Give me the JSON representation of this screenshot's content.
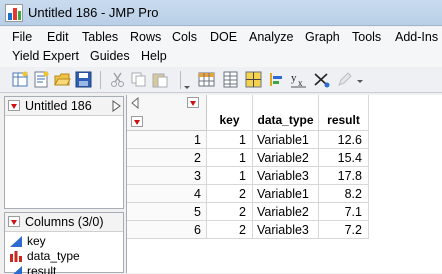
{
  "window": {
    "title": "Untitled 186 - JMP Pro"
  },
  "menu": {
    "row1": [
      "File",
      "Edit",
      "Tables",
      "Rows",
      "Cols",
      "DOE",
      "Analyze",
      "Graph",
      "Tools",
      "Add-Ins"
    ],
    "row2": [
      "Yield Expert",
      "Guides",
      "Help"
    ]
  },
  "toolbar": {
    "icons": [
      "new-data-table-icon",
      "new-script-icon",
      "open-icon",
      "save-icon",
      "cut-icon",
      "copy-icon",
      "paste-icon",
      "data-grid-icon",
      "tabulate-icon",
      "table-panel-icon",
      "distribution-icon",
      "fit-y-by-x-icon",
      "formula-icon",
      "edit-icon"
    ]
  },
  "table_panel": {
    "title": "Untitled 186"
  },
  "columns_panel": {
    "title": "Columns (3/0)",
    "items": [
      {
        "name": "key",
        "icon": "continuous-icon"
      },
      {
        "name": "data_type",
        "icon": "nominal-icon"
      },
      {
        "name": "result",
        "icon": "continuous-icon"
      }
    ]
  },
  "grid": {
    "columns": [
      "key",
      "data_type",
      "result"
    ],
    "rows": [
      {
        "row": "1",
        "key": "1",
        "data_type": "Variable1",
        "result": "12.6"
      },
      {
        "row": "2",
        "key": "1",
        "data_type": "Variable2",
        "result": "15.4"
      },
      {
        "row": "3",
        "key": "1",
        "data_type": "Variable3",
        "result": "17.8"
      },
      {
        "row": "4",
        "key": "2",
        "data_type": "Variable1",
        "result": "8.2"
      },
      {
        "row": "5",
        "key": "2",
        "data_type": "Variable2",
        "result": "7.1"
      },
      {
        "row": "6",
        "key": "2",
        "data_type": "Variable3",
        "result": "7.2"
      }
    ]
  },
  "colors": {
    "title_bar": "#c9dbee",
    "hot_spot": "#d11010",
    "continuous": "#2e6bd1",
    "nominal": "#c8281e"
  }
}
